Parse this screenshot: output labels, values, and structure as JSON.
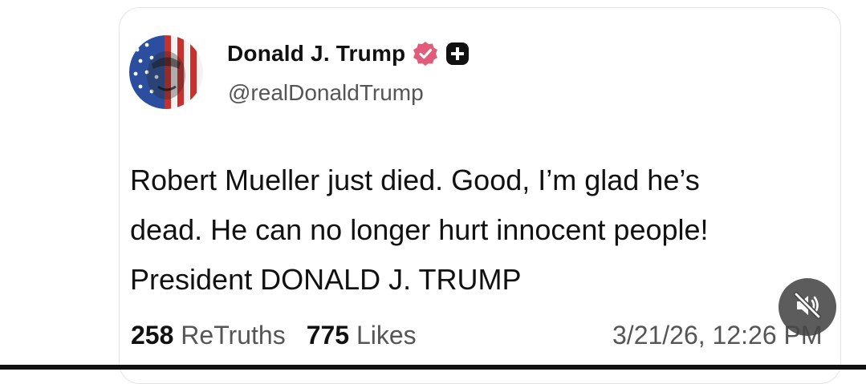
{
  "post": {
    "author_name": "Donald J. Trump",
    "handle": "@realDonaldTrump",
    "text_lines": [
      "Robert Mueller just died. Good, I’m glad he’s",
      "dead. He can no longer hurt innocent people!",
      "President DONALD J. TRUMP"
    ],
    "retruths_count": "258",
    "retruths_label": "ReTruths",
    "likes_count": "775",
    "likes_label": "Likes",
    "timestamp": "3/21/26, 12:26 PM"
  },
  "icons": {
    "verified": "verified-badge-icon",
    "plus": "plus-badge-icon",
    "mute": "speaker-muted-icon"
  },
  "colors": {
    "verified_badge": "#e25b7a",
    "text_primary": "#111111",
    "text_secondary": "#555555",
    "mute_button_bg": "#464646"
  }
}
